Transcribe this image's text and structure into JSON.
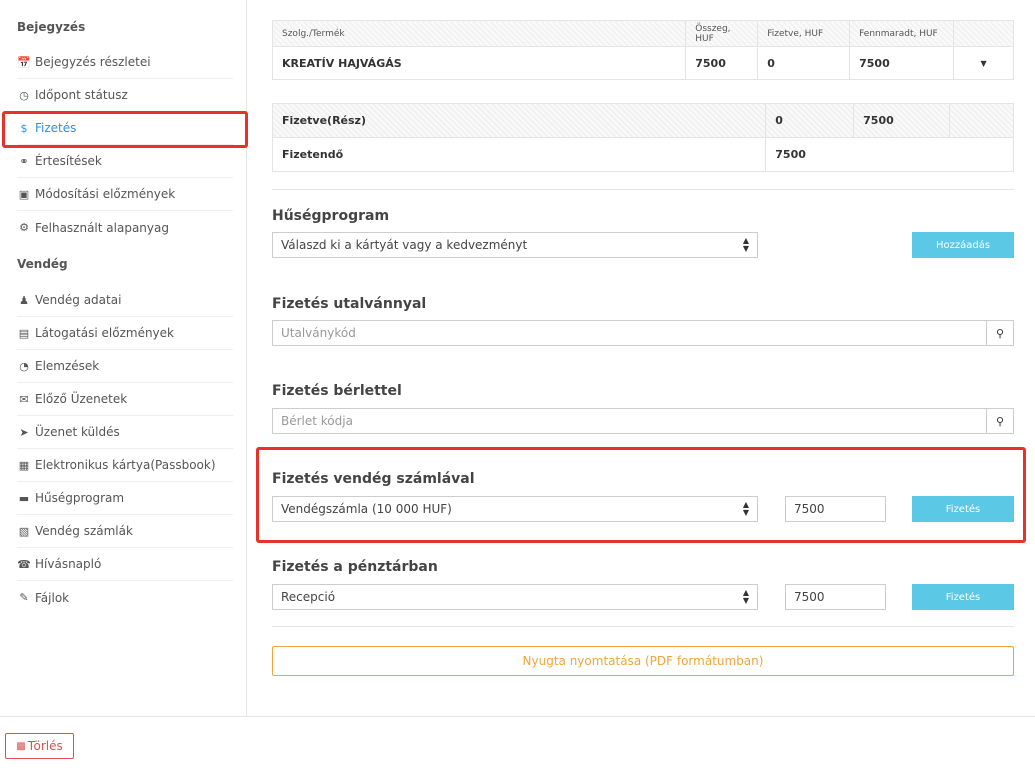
{
  "sidebar": {
    "section1": "Bejegyzés",
    "items1": [
      {
        "label": "Bejegyzés részletei",
        "icon": "calendar-icon"
      },
      {
        "label": "Időpont státusz",
        "icon": "clock-icon"
      },
      {
        "label": "Fizetés",
        "icon": "dollar-icon"
      },
      {
        "label": "Értesítések",
        "icon": "comment-icon"
      },
      {
        "label": "Módosítási előzmények",
        "icon": "file-icon"
      },
      {
        "label": "Felhasznált alapanyag",
        "icon": "cogs-icon"
      }
    ],
    "section2": "Vendég",
    "items2": [
      {
        "label": "Vendég adatai",
        "icon": "user-icon"
      },
      {
        "label": "Látogatási előzmények",
        "icon": "list-icon"
      },
      {
        "label": "Elemzések",
        "icon": "pie-chart-icon"
      },
      {
        "label": "Előző Üzenetek",
        "icon": "envelope-icon"
      },
      {
        "label": "Üzenet küldés",
        "icon": "send-icon"
      },
      {
        "label": "Elektronikus kártya(Passbook)",
        "icon": "qrcode-icon"
      },
      {
        "label": "Hűségprogram",
        "icon": "credit-card-icon"
      },
      {
        "label": "Vendég számlák",
        "icon": "briefcase-icon"
      },
      {
        "label": "Hívásnapló",
        "icon": "phone-icon"
      },
      {
        "label": "Fájlok",
        "icon": "paperclip-icon"
      }
    ]
  },
  "services_table": {
    "headers": [
      "Szolg./Termék",
      "Összeg, HUF",
      "Fizetve, HUF",
      "Fennmaradt, HUF"
    ],
    "row": {
      "name": "KREATÍV HAJVÁGÁS",
      "amount": "7500",
      "paid": "0",
      "remaining": "7500"
    }
  },
  "summary_table": {
    "paid_label": "Fizetve(Rész)",
    "paid_value": "0",
    "paid_remaining": "7500",
    "due_label": "Fizetendő",
    "due_value": "7500"
  },
  "loyalty": {
    "title": "Hűségprogram",
    "select_value": "Válaszd ki a kártyát vagy a kedvezményt",
    "button": "Hozzáadás"
  },
  "voucher": {
    "title": "Fizetés utalvánnyal",
    "placeholder": "Utalványkód"
  },
  "pass": {
    "title": "Fizetés bérlettel",
    "placeholder": "Bérlet kódja"
  },
  "guest_account": {
    "title": "Fizetés vendég számlával",
    "select_value": "Vendégszámla (10 000 HUF)",
    "amount": "7500",
    "button": "Fizetés"
  },
  "cashier": {
    "title": "Fizetés a pénztárban",
    "select_value": "Recepció",
    "amount": "7500",
    "button": "Fizetés"
  },
  "receipt_button": "Nyugta nyomtatása (PDF formátumban)",
  "delete_button": "Törlés",
  "colors": {
    "accent": "#2f8fe0",
    "cyan_button": "#5bc8e6",
    "highlight": "#e8312b",
    "orange": "#f2a43c",
    "danger": "#d9534f"
  }
}
